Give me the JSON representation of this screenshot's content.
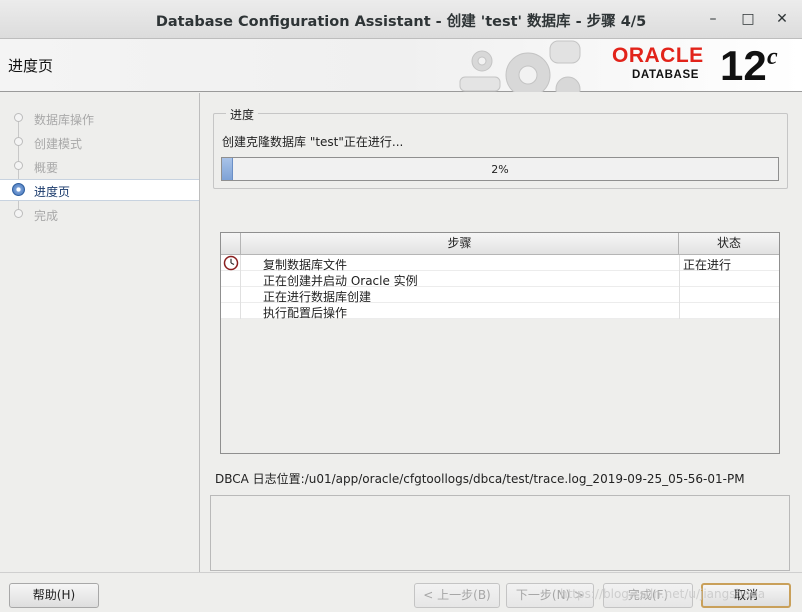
{
  "window": {
    "title": "Database Configuration Assistant - 创建 'test' 数据库 - 步骤 4/5",
    "minimize_glyph": "–",
    "maximize_glyph": "□",
    "close_glyph": "✕"
  },
  "header": {
    "page_title": "进度页",
    "logo": {
      "brand": "ORACLE",
      "product": "DATABASE",
      "version_number": "12",
      "version_suffix": "c",
      "brand_color": "#e2231a"
    }
  },
  "nav": {
    "items": [
      {
        "label": "数据库操作",
        "state": "done"
      },
      {
        "label": "创建模式",
        "state": "done"
      },
      {
        "label": "概要",
        "state": "done"
      },
      {
        "label": "进度页",
        "state": "active"
      },
      {
        "label": "完成",
        "state": "pending"
      }
    ]
  },
  "progress": {
    "group_label": "进度",
    "status_text": "创建克隆数据库 \"test\"正在进行...",
    "percent_text": "2%",
    "percent_value": 2
  },
  "steps_table": {
    "columns": [
      "步骤",
      "状态"
    ],
    "rows": [
      {
        "icon": "clock-icon",
        "step": "复制数据库文件",
        "status": "正在进行"
      },
      {
        "icon": "",
        "step": "正在创建并启动 Oracle 实例",
        "status": ""
      },
      {
        "icon": "",
        "step": "正在进行数据库创建",
        "status": ""
      },
      {
        "icon": "",
        "step": "执行配置后操作",
        "status": ""
      }
    ]
  },
  "log": {
    "text": "DBCA 日志位置:/u01/app/oracle/cfgtoollogs/dbca/test/trace.log_2019-09-25_05-56-01-PM"
  },
  "buttons": {
    "help": "帮助(H)",
    "back": "< 上一步(B)",
    "next": "下一步(N) >",
    "finish": "完成(F)",
    "cancel": "取消"
  },
  "watermark": "https://blog.csdn.net/u/jiangshaoa"
}
